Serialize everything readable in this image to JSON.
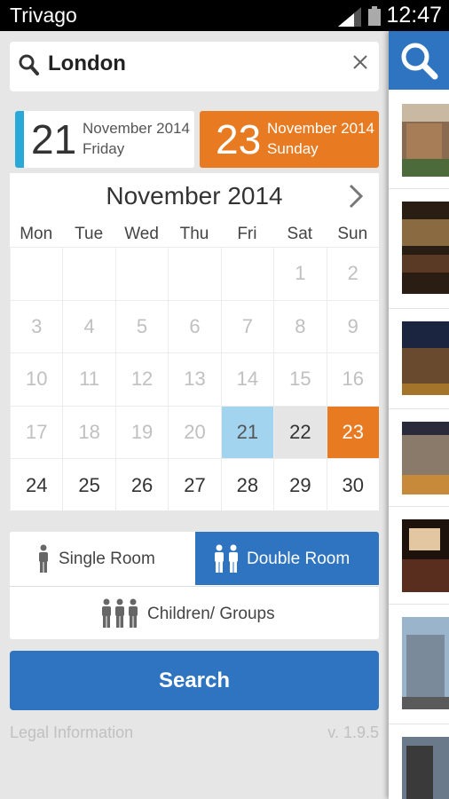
{
  "status": {
    "app": "Trivago",
    "time": "12:47"
  },
  "search": {
    "value": "London"
  },
  "checkin": {
    "day": "21",
    "month": "November 2014",
    "weekday": "Friday"
  },
  "checkout": {
    "day": "23",
    "month": "November 2014",
    "weekday": "Sunday"
  },
  "calendar": {
    "month": "November 2014",
    "dows": [
      "Mon",
      "Tue",
      "Wed",
      "Thu",
      "Fri",
      "Sat",
      "Sun"
    ],
    "cells": [
      "",
      "",
      "",
      "",
      "",
      "1",
      "2",
      "3",
      "4",
      "5",
      "6",
      "7",
      "8",
      "9",
      "10",
      "11",
      "12",
      "13",
      "14",
      "15",
      "16",
      "17",
      "18",
      "19",
      "20",
      "21",
      "22",
      "23",
      "24",
      "25",
      "26",
      "27",
      "28",
      "29",
      "30"
    ]
  },
  "rooms": {
    "single": "Single Room",
    "double": "Double Room",
    "groups": "Children/ Groups"
  },
  "search_button": "Search",
  "footer": {
    "legal": "Legal Information",
    "version": "v. 1.9.5"
  },
  "colors": {
    "accent_blue": "#2f74c0",
    "accent_orange": "#e87b22",
    "checkin_stripe": "#29a9d8",
    "checkin_cell": "#a2d4f0"
  }
}
